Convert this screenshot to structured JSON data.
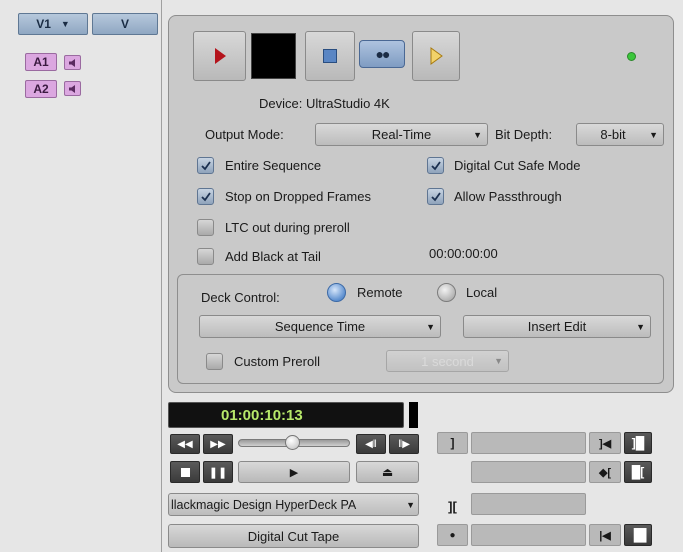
{
  "tracks": {
    "video_source": "V1",
    "video_record": "V",
    "audio": [
      {
        "label": "A1"
      },
      {
        "label": "A2"
      }
    ]
  },
  "device": {
    "label": "Device:",
    "name": "UltraStudio 4K"
  },
  "output_mode": {
    "label": "Output Mode:",
    "value": "Real-Time"
  },
  "bit_depth": {
    "label": "Bit Depth:",
    "value": "8-bit"
  },
  "options": {
    "entire_sequence": {
      "label": "Entire Sequence",
      "checked": true
    },
    "digital_cut_safe_mode": {
      "label": "Digital Cut Safe Mode",
      "checked": true
    },
    "stop_on_dropped_frames": {
      "label": "Stop on Dropped Frames",
      "checked": true
    },
    "allow_passthrough": {
      "label": "Allow Passthrough",
      "checked": true
    },
    "ltc_out_during_preroll": {
      "label": "LTC out during preroll",
      "checked": false
    },
    "add_black_at_tail": {
      "label": "Add Black at Tail",
      "checked": false
    }
  },
  "black_duration": "00:00:00:00",
  "deck_control": {
    "label": "Deck Control:",
    "remote_label": "Remote",
    "local_label": "Local",
    "selected": "Remote",
    "time_source": "Sequence Time",
    "edit_mode": "Insert Edit",
    "custom_preroll_label": "Custom Preroll",
    "custom_preroll_checked": false,
    "preroll_value": "1 second"
  },
  "timecode": "01:00:10:13",
  "deck_name": "llackmagic Design HyperDeck PA",
  "tape_button": "Digital Cut Tape",
  "status_led_color": "#3cc63c"
}
